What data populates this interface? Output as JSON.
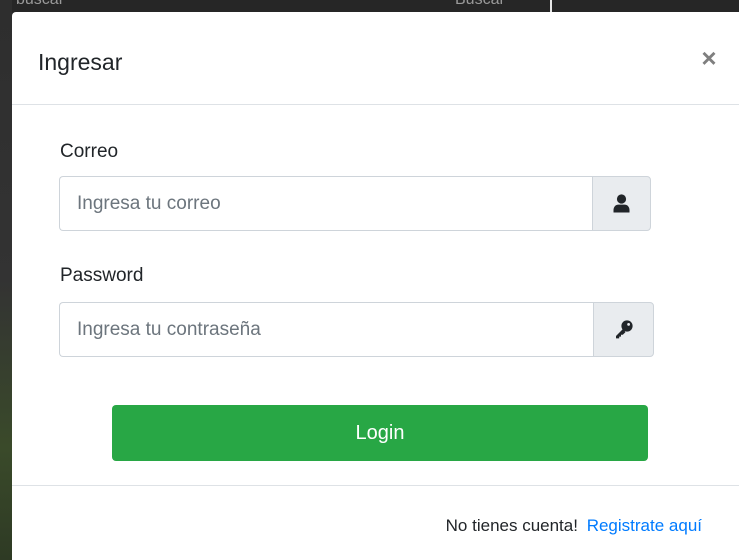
{
  "background": {
    "search_placeholder": "buscar",
    "search_button_label": "Buscar"
  },
  "modal": {
    "title": "Ingresar",
    "close_icon": "close-icon",
    "close_glyph": "×",
    "email": {
      "label": "Correo",
      "placeholder": "Ingresa tu correo",
      "value": "",
      "icon": "user-icon"
    },
    "password": {
      "label": "Password",
      "placeholder": "Ingresa tu contraseña",
      "value": "",
      "icon": "key-icon"
    },
    "login_label": "Login",
    "footer": {
      "prompt": "No tienes cuenta!",
      "register_link": "Registrate aquí"
    }
  },
  "colors": {
    "primary_button": "#28a745",
    "link": "#007bff",
    "addon_background": "#e9ecef"
  }
}
